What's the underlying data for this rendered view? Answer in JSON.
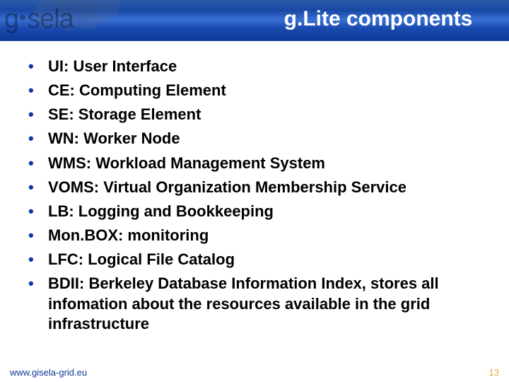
{
  "header": {
    "logo_text_left": "g",
    "logo_text_mid": "s",
    "logo_text_right": "ela",
    "title": "g.Lite components"
  },
  "bullets": [
    "UI: User Interface",
    "CE: Computing Element",
    "SE: Storage Element",
    "WN: Worker Node",
    "WMS: Workload Management System",
    "VOMS: Virtual Organization Membership Service",
    "LB: Logging and Bookkeeping",
    "Mon.BOX: monitoring",
    "LFC: Logical File Catalog",
    "BDII: Berkeley Database Information Index, stores all infomation about the resources available in the grid infrastructure"
  ],
  "footer": {
    "url": "www.gisela-grid.eu",
    "page": "13"
  }
}
